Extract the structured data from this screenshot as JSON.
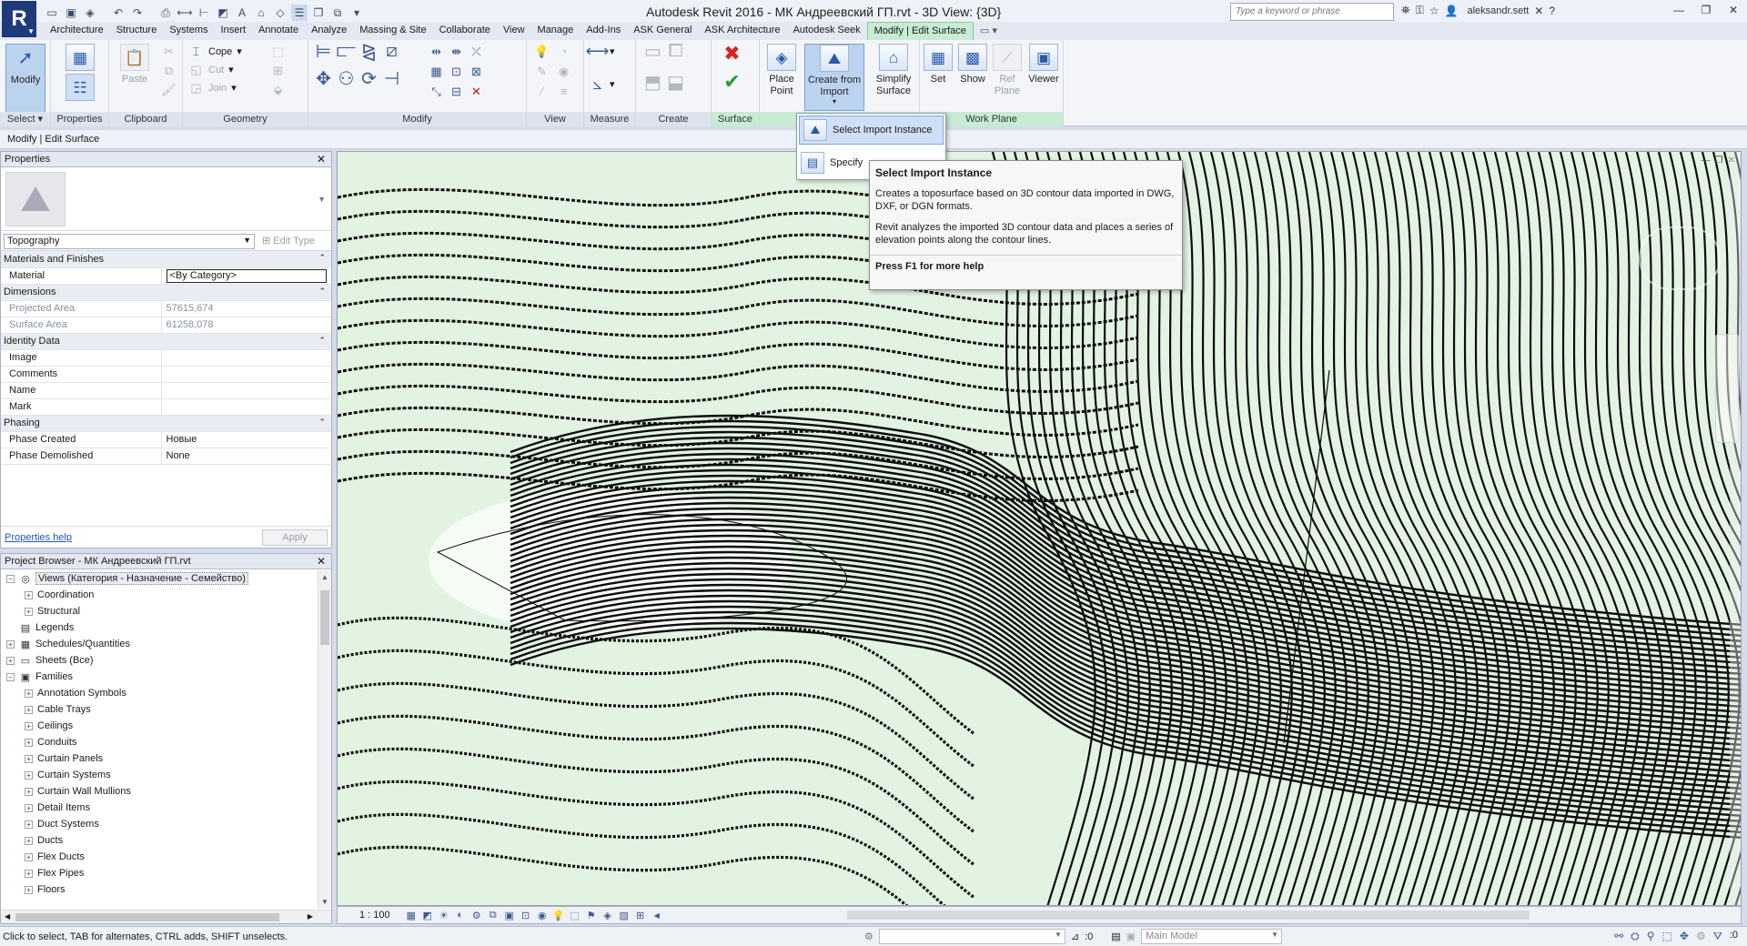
{
  "app": {
    "title": "Autodesk Revit 2016 -     МК Андреевский ГП.rvt - 3D View: {3D}",
    "logo": "R",
    "search_placeholder": "Type a keyword or phrase",
    "user": "aleksandr.sett"
  },
  "ribbon_tabs": [
    "Architecture",
    "Structure",
    "Systems",
    "Insert",
    "Annotate",
    "Analyze",
    "Massing & Site",
    "Collaborate",
    "View",
    "Manage",
    "Add-Ins",
    "ASK General",
    "ASK Architecture",
    "Autodesk Seek",
    "Modify | Edit Surface"
  ],
  "ribbon": {
    "select": {
      "modify": "Modify",
      "label": "Select"
    },
    "properties": {
      "label": "Properties"
    },
    "clipboard": {
      "paste": "Paste",
      "label": "Clipboard"
    },
    "geometry": {
      "cope": "Cope",
      "cut": "Cut",
      "join": "Join",
      "label": "Geometry"
    },
    "modify": {
      "label": "Modify"
    },
    "view": {
      "label": "View"
    },
    "measure": {
      "label": "Measure"
    },
    "create": {
      "label": "Create"
    },
    "surface": {
      "label": "Surface"
    },
    "tools": {
      "place_point": "Place Point",
      "create_from_import": "Create from Import",
      "simplify_surface": "Simplify Surface"
    },
    "work_plane": {
      "set": "Set",
      "show": "Show",
      "ref_plane": "Ref Plane",
      "viewer": "Viewer",
      "label": "Work Plane"
    }
  },
  "context_bar": "Modify | Edit Surface",
  "dropdown": {
    "item1": "Select Import Instance",
    "item2": "Specify"
  },
  "tooltip": {
    "title": "Select Import Instance",
    "body1": "Creates a toposurface based on 3D contour data imported in DWG, DXF, or DGN formats.",
    "body2": "Revit analyzes the imported 3D contour data and places a series of elevation points along the contour lines.",
    "help": "Press F1 for more help"
  },
  "properties": {
    "header": "Properties",
    "type": "Topography",
    "edit_type": "Edit Type",
    "groups": [
      {
        "name": "Materials and Finishes",
        "rows": [
          {
            "k": "Material",
            "v": "<By Category>"
          }
        ]
      },
      {
        "name": "Dimensions",
        "rows": [
          {
            "k": "Projected Area",
            "v": "57615,674"
          },
          {
            "k": "Surface Area",
            "v": "61258,078"
          }
        ]
      },
      {
        "name": "Identity Data",
        "rows": [
          {
            "k": "Image",
            "v": ""
          },
          {
            "k": "Comments",
            "v": ""
          },
          {
            "k": "Name",
            "v": ""
          },
          {
            "k": "Mark",
            "v": ""
          }
        ]
      },
      {
        "name": "Phasing",
        "rows": [
          {
            "k": "Phase Created",
            "v": "Новые"
          },
          {
            "k": "Phase Demolished",
            "v": "None"
          }
        ]
      }
    ],
    "help_link": "Properties help",
    "apply": "Apply"
  },
  "browser": {
    "header": "Project Browser - МК Андреевский ГП.rvt",
    "nodes": [
      {
        "label": "Views (Категория - Назначение - Семейство)",
        "level": 0,
        "sign": "−",
        "icon": "◎"
      },
      {
        "label": "Coordination",
        "level": 1,
        "sign": "+",
        "icon": ""
      },
      {
        "label": "Structural",
        "level": 1,
        "sign": "+",
        "icon": ""
      },
      {
        "label": "Legends",
        "level": 0,
        "sign": "",
        "icon": "▤"
      },
      {
        "label": "Schedules/Quantities",
        "level": 0,
        "sign": "+",
        "icon": "▦"
      },
      {
        "label": "Sheets (Все)",
        "level": 0,
        "sign": "+",
        "icon": "▭"
      },
      {
        "label": "Families",
        "level": 0,
        "sign": "−",
        "icon": "▣"
      },
      {
        "label": "Annotation Symbols",
        "level": 1,
        "sign": "+",
        "icon": ""
      },
      {
        "label": "Cable Trays",
        "level": 1,
        "sign": "+",
        "icon": ""
      },
      {
        "label": "Ceilings",
        "level": 1,
        "sign": "+",
        "icon": ""
      },
      {
        "label": "Conduits",
        "level": 1,
        "sign": "+",
        "icon": ""
      },
      {
        "label": "Curtain Panels",
        "level": 1,
        "sign": "+",
        "icon": ""
      },
      {
        "label": "Curtain Systems",
        "level": 1,
        "sign": "+",
        "icon": ""
      },
      {
        "label": "Curtain Wall Mullions",
        "level": 1,
        "sign": "+",
        "icon": ""
      },
      {
        "label": "Detail Items",
        "level": 1,
        "sign": "+",
        "icon": ""
      },
      {
        "label": "Duct Systems",
        "level": 1,
        "sign": "+",
        "icon": ""
      },
      {
        "label": "Ducts",
        "level": 1,
        "sign": "+",
        "icon": ""
      },
      {
        "label": "Flex Ducts",
        "level": 1,
        "sign": "+",
        "icon": ""
      },
      {
        "label": "Flex Pipes",
        "level": 1,
        "sign": "+",
        "icon": ""
      },
      {
        "label": "Floors",
        "level": 1,
        "sign": "+",
        "icon": ""
      }
    ]
  },
  "viewbar": {
    "scale": "1 : 100"
  },
  "status": {
    "text": "Click to select, TAB for alternates, CTRL adds, SHIFT unselects.",
    "zero1": ":0",
    "model": "Main Model",
    "zero2": ":0"
  }
}
